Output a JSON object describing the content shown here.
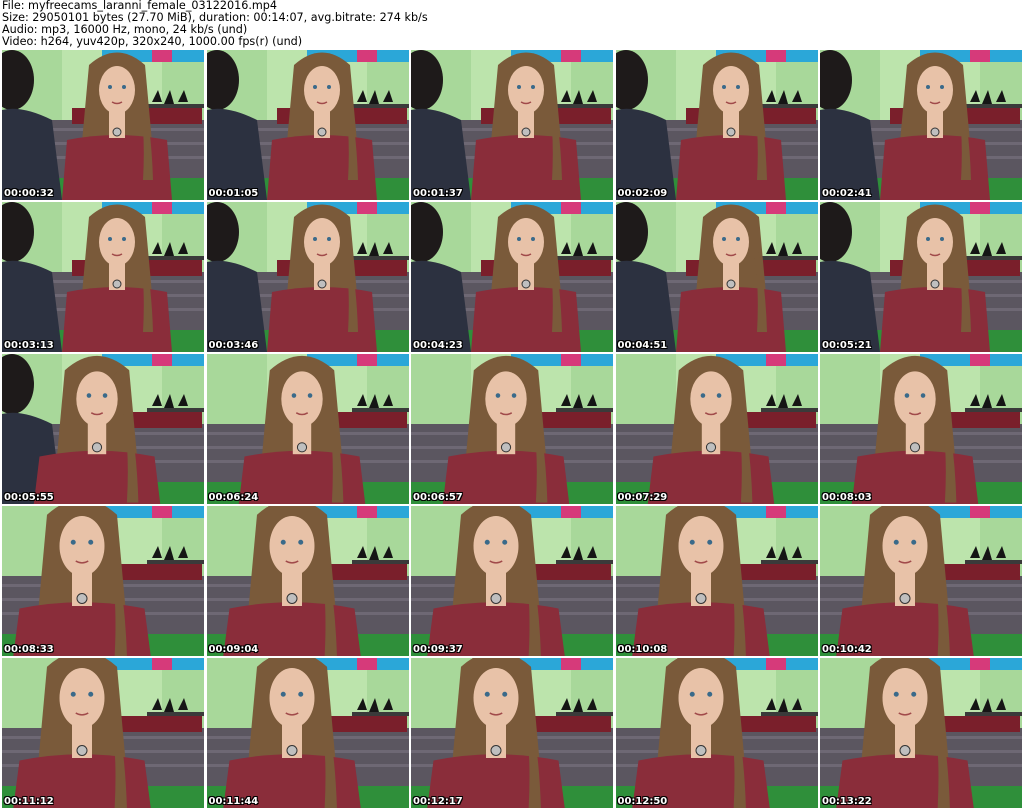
{
  "header": {
    "file": "File: myfreecams_laranni_female_03122016.mp4",
    "size": "Size: 29050101 bytes (27.70 MiB), duration: 00:14:07, avg.bitrate: 274 kb/s",
    "audio": "Audio: mp3, 16000 Hz, mono, 24 kb/s (und)",
    "video": "Video: h264, yuv420p, 320x240, 1000.00 fps(r) (und)"
  },
  "frames": [
    {
      "time": "00:00:32"
    },
    {
      "time": "00:01:05"
    },
    {
      "time": "00:01:37"
    },
    {
      "time": "00:02:09"
    },
    {
      "time": "00:02:41"
    },
    {
      "time": "00:03:13"
    },
    {
      "time": "00:03:46"
    },
    {
      "time": "00:04:23"
    },
    {
      "time": "00:04:51"
    },
    {
      "time": "00:05:21"
    },
    {
      "time": "00:05:55"
    },
    {
      "time": "00:06:24"
    },
    {
      "time": "00:06:57"
    },
    {
      "time": "00:07:29"
    },
    {
      "time": "00:08:03"
    },
    {
      "time": "00:08:33"
    },
    {
      "time": "00:09:04"
    },
    {
      "time": "00:09:37"
    },
    {
      "time": "00:10:08"
    },
    {
      "time": "00:10:42"
    },
    {
      "time": "00:11:12"
    },
    {
      "time": "00:11:44"
    },
    {
      "time": "00:12:17"
    },
    {
      "time": "00:12:50"
    },
    {
      "time": "00:13:22"
    }
  ],
  "colors": {
    "wall": "#a8d89a",
    "wall_light": "#c9ecb9",
    "couch": "#5b5660",
    "blanket": "#2f8f3a",
    "shelf_blue": "#2ba7d8",
    "dress": "#8a2d3a",
    "hair": "#7a5a3a",
    "skin": "#e8c2a8",
    "companion_top": "#2c3140",
    "companion_hair": "#1e1a1a",
    "shoes": "#151515",
    "timestamp": "#ffffff"
  }
}
